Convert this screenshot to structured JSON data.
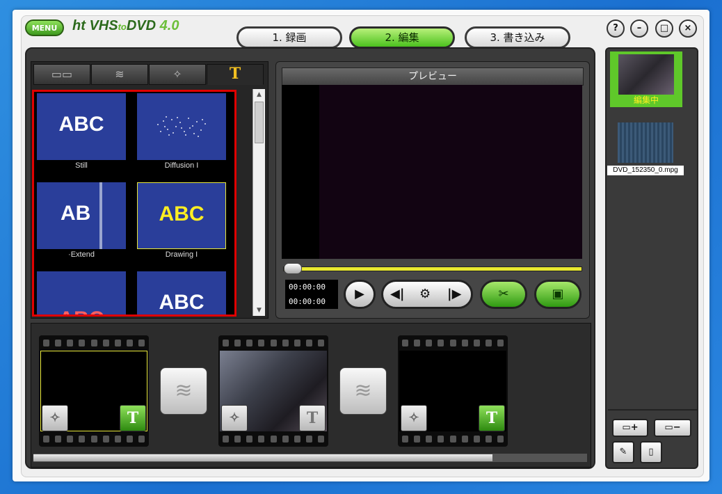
{
  "header": {
    "menu_label": "MENU",
    "logo_ht": "ht",
    "logo_vhs": "VHS",
    "logo_to": "to",
    "logo_dvd": "DVD",
    "logo_version": "4.0"
  },
  "tabs": [
    {
      "label": "1. 録画",
      "active": false
    },
    {
      "label": "2. 編集",
      "active": true
    },
    {
      "label": "3. 書き込み",
      "active": false
    }
  ],
  "window_controls": {
    "help": "?",
    "minimize": "–",
    "maximize": "□",
    "close": "×"
  },
  "left_panel": {
    "tab_icons": [
      "filmstrip-icon",
      "transition-icon",
      "magic-wand-icon",
      "text-icon"
    ],
    "text_tab_glyph": "T",
    "effects": [
      {
        "label": "Still",
        "preview_text": "ABC"
      },
      {
        "label": "Diffusion I",
        "preview_text": ""
      },
      {
        "label": "·Extend",
        "preview_text": "AB"
      },
      {
        "label": "Drawing I",
        "preview_text": "ABC",
        "selected": true
      },
      {
        "label": "",
        "preview_text": "ABC"
      },
      {
        "label": "",
        "preview_text": "ABC"
      }
    ]
  },
  "preview": {
    "title": "プレビュー",
    "time_current": "00:00:00",
    "time_total": "00:00:00",
    "seek_progress": 0
  },
  "timeline": {
    "clips": [
      {
        "type": "empty",
        "selected": true,
        "has_text": true
      },
      {
        "type": "video",
        "selected": false,
        "has_text": false
      },
      {
        "type": "empty",
        "selected": false,
        "has_text": true
      }
    ],
    "scroll_fraction": 0.83
  },
  "right_panel": {
    "active_caption": "編集中",
    "file_caption": "DVD_152350_0.mpg"
  },
  "colors": {
    "accent_green": "#4cc21e",
    "highlight_yellow": "#ffee22",
    "red_border": "#e00000"
  }
}
